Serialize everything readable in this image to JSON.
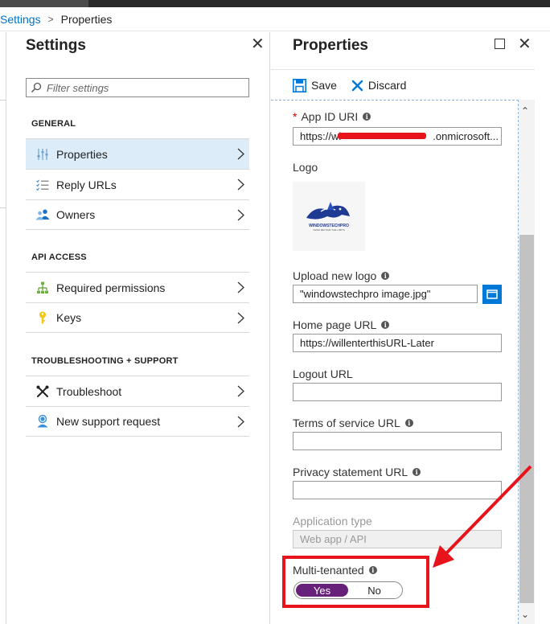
{
  "breadcrumb": {
    "parent": "Settings",
    "separator": ">",
    "current": "Properties"
  },
  "settings_blade": {
    "title": "Settings",
    "search_placeholder": "Filter settings",
    "groups": [
      {
        "header": "GENERAL",
        "items": [
          {
            "label": "Properties",
            "icon": "properties-icon",
            "selected": true
          },
          {
            "label": "Reply URLs",
            "icon": "list-icon",
            "selected": false
          },
          {
            "label": "Owners",
            "icon": "users-icon",
            "selected": false
          }
        ]
      },
      {
        "header": "API ACCESS",
        "items": [
          {
            "label": "Required permissions",
            "icon": "hierarchy-icon",
            "selected": false
          },
          {
            "label": "Keys",
            "icon": "key-icon",
            "selected": false
          }
        ]
      },
      {
        "header": "TROUBLESHOOTING + SUPPORT",
        "items": [
          {
            "label": "Troubleshoot",
            "icon": "wrench-icon",
            "selected": false
          },
          {
            "label": "New support request",
            "icon": "support-person-icon",
            "selected": false
          }
        ]
      }
    ]
  },
  "properties_blade": {
    "title": "Properties",
    "commands": {
      "save": "Save",
      "discard": "Discard"
    },
    "fields": {
      "app_id_uri": {
        "required_mark": "*",
        "label": "App ID URI",
        "value_start": "https://wi",
        "value_end": ".onmicrosoft..."
      },
      "logo": {
        "label": "Logo",
        "image_text": "WINDOWSTECHPRO",
        "image_subtext": "THINK BEYOND THE LIMITS"
      },
      "upload_logo": {
        "label": "Upload new logo",
        "value": "\"windowstechpro image.jpg\""
      },
      "home_page_url": {
        "label": "Home page URL",
        "value": "https://willenterthisURL-Later"
      },
      "logout_url": {
        "label": "Logout URL",
        "value": ""
      },
      "terms_url": {
        "label": "Terms of service URL",
        "value": ""
      },
      "privacy_url": {
        "label": "Privacy statement URL",
        "value": ""
      },
      "application_type": {
        "label": "Application type",
        "value": "Web app / API"
      },
      "multi_tenanted": {
        "label": "Multi-tenanted",
        "options": [
          "Yes",
          "No"
        ],
        "selected": "Yes"
      }
    }
  },
  "colors": {
    "accent": "#0078d7",
    "link": "#0072c6",
    "toggle_on": "#68217a",
    "annotation_red": "#e8141c",
    "selected_row": "#dcecf8"
  }
}
